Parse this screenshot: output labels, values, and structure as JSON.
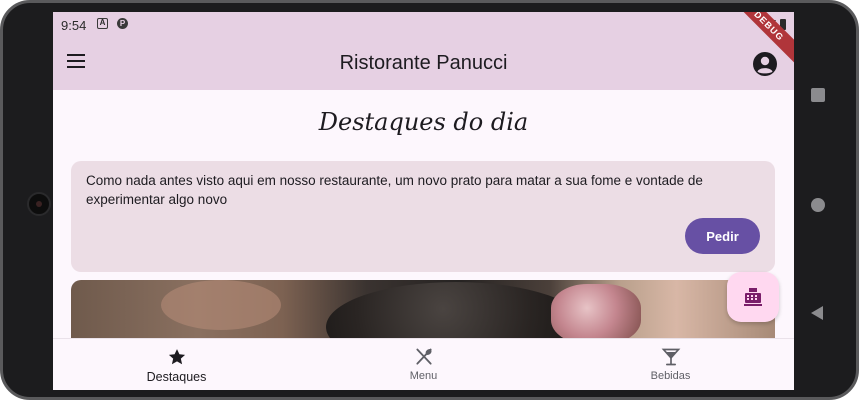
{
  "status_bar": {
    "time": "9:54",
    "icon_a": "A",
    "icon_p": "P",
    "debug_label": "DEBUG"
  },
  "app_bar": {
    "title": "Ristorante Panucci"
  },
  "page": {
    "heading": "Destaques do dia"
  },
  "highlight_card": {
    "description": "Como nada antes visto aqui em nosso restaurante, um novo prato para matar a sua fome e vontade de experimentar algo novo",
    "order_label": "Pedir"
  },
  "bottom_nav": {
    "items": [
      {
        "label": "Destaques",
        "icon": "star-icon",
        "active": true
      },
      {
        "label": "Menu",
        "icon": "utensils-icon",
        "active": false
      },
      {
        "label": "Bebidas",
        "icon": "cocktail-icon",
        "active": false
      }
    ]
  },
  "colors": {
    "app_bar": "#e6d0e3",
    "background": "#fdf7fd",
    "card": "#ecdde5",
    "primary_button": "#6750a4",
    "fab": "#ffd8f0",
    "debug_banner": "#b0353a"
  }
}
